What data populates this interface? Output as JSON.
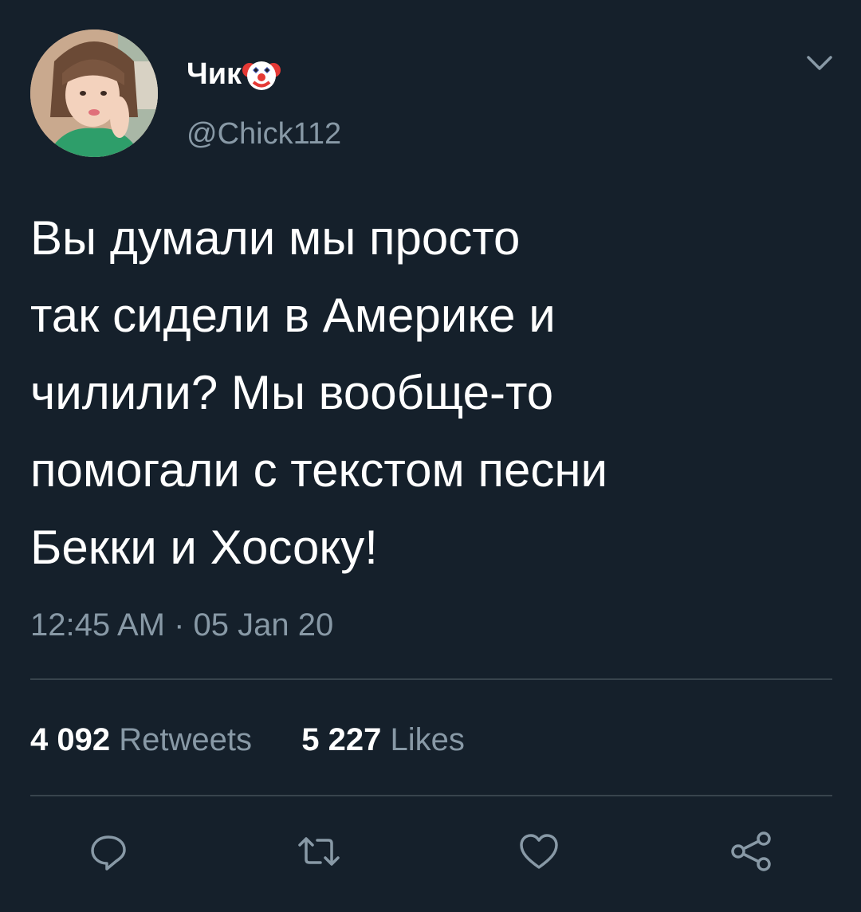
{
  "tweet": {
    "author": {
      "display_name": "Чик",
      "name_emoji": "clown-face-icon",
      "handle": "@Chick112"
    },
    "text_lines": [
      "Вы думали мы просто",
      "так сидели в Америке и",
      "чилили? Мы вообще-то",
      "помогали с текстом песни",
      "Бекки и Хосоку!"
    ],
    "timestamp": "12:45 AM · 05 Jan 20",
    "stats": {
      "retweets_count": "4 092",
      "retweets_label": "Retweets",
      "likes_count": "5 227",
      "likes_label": "Likes"
    },
    "actions": [
      "reply-icon",
      "retweet-icon",
      "like-icon",
      "share-icon"
    ]
  },
  "colors": {
    "background": "#15202b",
    "text": "#ffffff",
    "secondary_text": "#8899a6",
    "divider": "#38444d"
  }
}
